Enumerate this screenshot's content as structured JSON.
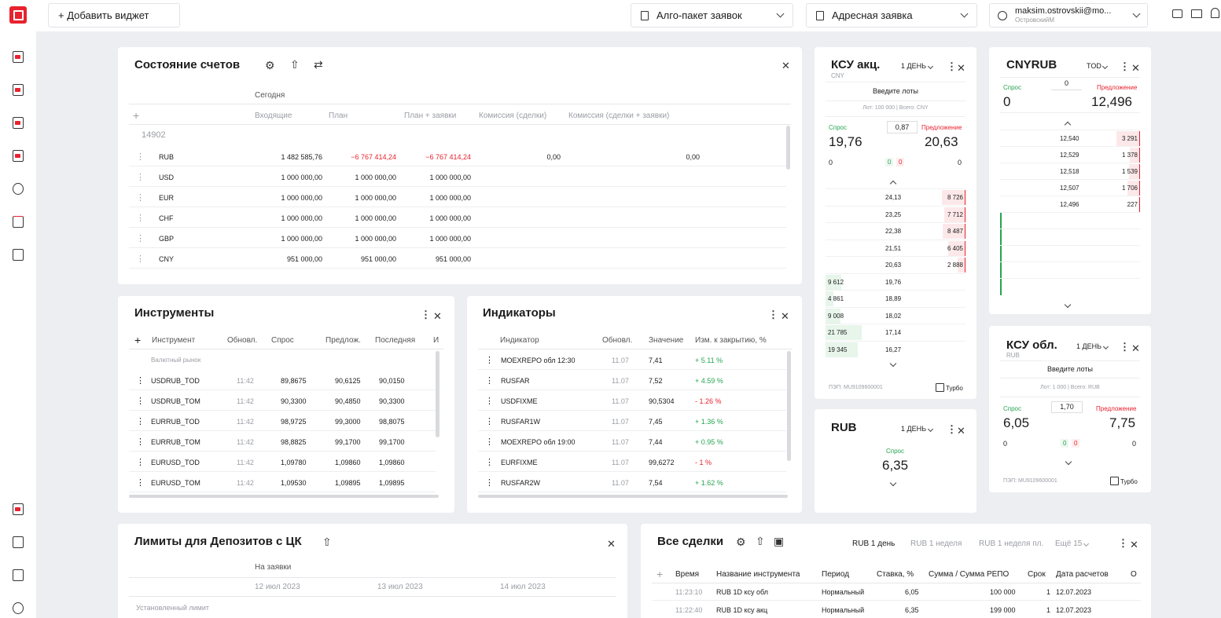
{
  "topbar": {
    "add_widget": "+ Добавить виджет",
    "algo": "Алго-пакет заявок",
    "address": "Адресная заявка",
    "user_email": "maksim.ostrovskii@mo...",
    "user_name": "ОстровскийМ"
  },
  "accounts": {
    "title": "Состояние счетов",
    "group": "Сегодня",
    "cols": [
      "Входящие",
      "План",
      "План + заявки",
      "Комиссия (сделки)",
      "Комиссия (сделки + заявки)"
    ],
    "account": "14902",
    "rows": [
      {
        "cur": "RUB",
        "in": "1 482 585,76",
        "plan": "−6 767 414,24",
        "plan_orders": "−6 767 414,24",
        "comm": "0,00",
        "comm2": "0,00"
      },
      {
        "cur": "USD",
        "in": "1 000 000,00",
        "plan": "1 000 000,00",
        "plan_orders": "1 000 000,00",
        "comm": "",
        "comm2": ""
      },
      {
        "cur": "EUR",
        "in": "1 000 000,00",
        "plan": "1 000 000,00",
        "plan_orders": "1 000 000,00",
        "comm": "",
        "comm2": ""
      },
      {
        "cur": "CHF",
        "in": "1 000 000,00",
        "plan": "1 000 000,00",
        "plan_orders": "1 000 000,00",
        "comm": "",
        "comm2": ""
      },
      {
        "cur": "GBP",
        "in": "1 000 000,00",
        "plan": "1 000 000,00",
        "plan_orders": "1 000 000,00",
        "comm": "",
        "comm2": ""
      },
      {
        "cur": "CNY",
        "in": "951 000,00",
        "plan": "951 000,00",
        "plan_orders": "951 000,00",
        "comm": "",
        "comm2": ""
      }
    ]
  },
  "instruments": {
    "title": "Инструменты",
    "cols": [
      "Инструмент",
      "Обновл.",
      "Спрос",
      "Предлож.",
      "Последняя",
      "И"
    ],
    "group": "Валютный рынок",
    "rows": [
      {
        "name": "USDRUB_TOD",
        "time": "11:42",
        "bid": "89,8675",
        "ask": "90,6125",
        "last": "90,0150"
      },
      {
        "name": "USDRUB_TOM",
        "time": "11:42",
        "bid": "90,3300",
        "ask": "90,4850",
        "last": "90,3300"
      },
      {
        "name": "EURRUB_TOD",
        "time": "11:42",
        "bid": "98,9725",
        "ask": "99,3000",
        "last": "98,8075"
      },
      {
        "name": "EURRUB_TOM",
        "time": "11:42",
        "bid": "98,8825",
        "ask": "99,1700",
        "last": "99,1700"
      },
      {
        "name": "EURUSD_TOD",
        "time": "11:42",
        "bid": "1,09780",
        "ask": "1,09860",
        "last": "1,09860"
      },
      {
        "name": "EURUSD_TOM",
        "time": "11:42",
        "bid": "1,09530",
        "ask": "1,09895",
        "last": "1,09895"
      }
    ]
  },
  "indicators": {
    "title": "Индикаторы",
    "cols": [
      "Индикатор",
      "Обновл.",
      "Значение",
      "Изм. к закрытию, %"
    ],
    "rows": [
      {
        "name": "MOEXREPO обл 12:30",
        "date": "11.07",
        "value": "7,41",
        "chg": "+ 5.11 %",
        "pos": true
      },
      {
        "name": "RUSFAR",
        "date": "11.07",
        "value": "7,52",
        "chg": "+ 4.59 %",
        "pos": true
      },
      {
        "name": "USDFIXME",
        "date": "11.07",
        "value": "90,5304",
        "chg": "- 1.26 %",
        "pos": false
      },
      {
        "name": "RUSFAR1W",
        "date": "11.07",
        "value": "7,45",
        "chg": "+ 1.36 %",
        "pos": true
      },
      {
        "name": "MOEXREPO обл 19:00",
        "date": "11.07",
        "value": "7,44",
        "chg": "+ 0.95 %",
        "pos": true
      },
      {
        "name": "EURFIXME",
        "date": "11.07",
        "value": "99,6272",
        "chg": "- 1 %",
        "pos": false
      },
      {
        "name": "RUSFAR2W",
        "date": "11.07",
        "value": "7,54",
        "chg": "+ 1.62 %",
        "pos": true
      }
    ]
  },
  "ksu_akc": {
    "title": "КСУ акц.",
    "sub": "CNY",
    "term": "1 ДЕНЬ",
    "lots": "Введите лоты",
    "lot_info": "Лот: 100 000 | Всего: CNY",
    "bid_label": "Спрос",
    "ask_label": "Предложение",
    "qty": "0,87",
    "bid": "19,76",
    "ask": "20,63",
    "left0": "0",
    "right0": "0",
    "mini0": "0",
    "mini1": "0",
    "asks": [
      {
        "p": "24,13",
        "v": "8 726"
      },
      {
        "p": "23,25",
        "v": "7 712"
      },
      {
        "p": "22,38",
        "v": "8 487"
      },
      {
        "p": "21,51",
        "v": "6 405"
      },
      {
        "p": "20,63",
        "v": "2 888"
      }
    ],
    "bids": [
      {
        "p": "19,76",
        "v": "9 612"
      },
      {
        "p": "18,89",
        "v": "4 861"
      },
      {
        "p": "18,02",
        "v": "9 008"
      },
      {
        "p": "17,14",
        "v": "21 785"
      },
      {
        "p": "16,27",
        "v": "19 345"
      }
    ],
    "pzp": "ПЭП: MU9109600001",
    "turbo": "Турбо"
  },
  "cnyrub": {
    "title": "CNYRUB",
    "term": "TOD",
    "bid_label": "Спрос",
    "ask_label": "Предложение",
    "qty": "0",
    "bid": "0",
    "ask": "12,496",
    "asks": [
      {
        "p": "12,540",
        "v": "3 291"
      },
      {
        "p": "12,529",
        "v": "1 378"
      },
      {
        "p": "12,518",
        "v": "1 539"
      },
      {
        "p": "12,507",
        "v": "1 706"
      },
      {
        "p": "12,496",
        "v": "227"
      }
    ]
  },
  "rub": {
    "title": "RUB",
    "term": "1 ДЕНЬ",
    "bid_label": "Спрос",
    "bid": "6,35"
  },
  "ksu_obl": {
    "title": "КСУ обл.",
    "sub": "RUB",
    "term": "1 ДЕНЬ",
    "lots": "Введите лоты",
    "lot_info": "Лот: 1 000 | Всего: RUB",
    "bid_label": "Спрос",
    "ask_label": "Предложение",
    "qty": "1,70",
    "bid": "6,05",
    "ask": "7,75",
    "left0": "0",
    "right0": "0",
    "mini0": "0",
    "mini1": "0",
    "pzp": "ПЭП: MU9109600001",
    "turbo": "Турбо"
  },
  "limits": {
    "title": "Лимиты для Депозитов с ЦК",
    "group": "На заявки",
    "dates": [
      "12 июл 2023",
      "13 июл 2023",
      "14 июл 2023"
    ],
    "row": "Установленный лимит"
  },
  "deals": {
    "title": "Все сделки",
    "tabs": [
      "RUB 1 день",
      "RUB 1 неделя",
      "RUB 1 неделя пл.",
      "Ещё 15"
    ],
    "cols": [
      "Время",
      "Название инструмента",
      "Период",
      "Ставка, %",
      "Сумма / Сумма РЕПО",
      "Срок",
      "Дата расчетов",
      "О"
    ],
    "rows": [
      {
        "time": "11:23:10",
        "name": "RUB 1D ксу обл",
        "period": "Нормальный",
        "rate": "6,05",
        "sum": "100 000",
        "term": "1",
        "date": "12.07.2023"
      },
      {
        "time": "11:22:40",
        "name": "RUB 1D ксу акц",
        "period": "Нормальный",
        "rate": "6,35",
        "sum": "199 000",
        "term": "1",
        "date": "12.07.2023"
      }
    ]
  },
  "colors": {
    "accent": "#e7232e",
    "green": "#27a452",
    "bg": "#edeef2"
  }
}
